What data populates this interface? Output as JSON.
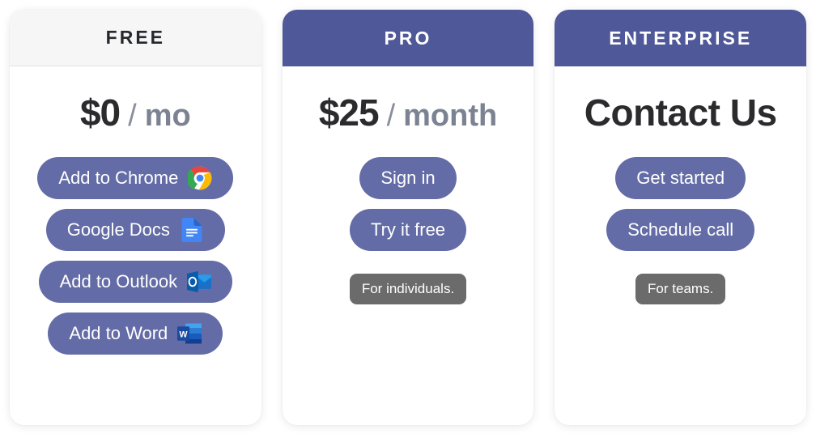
{
  "colors": {
    "accent_header": "#4f5899",
    "accent_button": "#636ca6",
    "badge_gray": "#6b6b6b",
    "price_text": "#2b2b2e",
    "period_text": "#7b8291",
    "light_header_bg": "#f6f6f7"
  },
  "plans": [
    {
      "id": "free",
      "header_label": "FREE",
      "header_style": "light",
      "price_amount": "$0",
      "price_separator": "/",
      "price_period": "mo",
      "buttons": [
        {
          "label": "Add to Chrome",
          "icon": "chrome-icon"
        },
        {
          "label": "Google Docs",
          "icon": "google-docs-icon"
        },
        {
          "label": "Add to Outlook",
          "icon": "outlook-icon"
        },
        {
          "label": "Add to Word",
          "icon": "word-icon"
        }
      ],
      "note": ""
    },
    {
      "id": "pro",
      "header_label": "PRO",
      "header_style": "accent",
      "price_amount": "$25",
      "price_separator": "/",
      "price_period": "month",
      "buttons": [
        {
          "label": "Sign in",
          "icon": ""
        },
        {
          "label": "Try it free",
          "icon": ""
        }
      ],
      "note": "For individuals."
    },
    {
      "id": "enterprise",
      "header_label": "ENTERPRISE",
      "header_style": "accent",
      "price_contact": "Contact Us",
      "buttons": [
        {
          "label": "Get started",
          "icon": ""
        },
        {
          "label": "Schedule call",
          "icon": ""
        }
      ],
      "note": "For teams."
    }
  ]
}
